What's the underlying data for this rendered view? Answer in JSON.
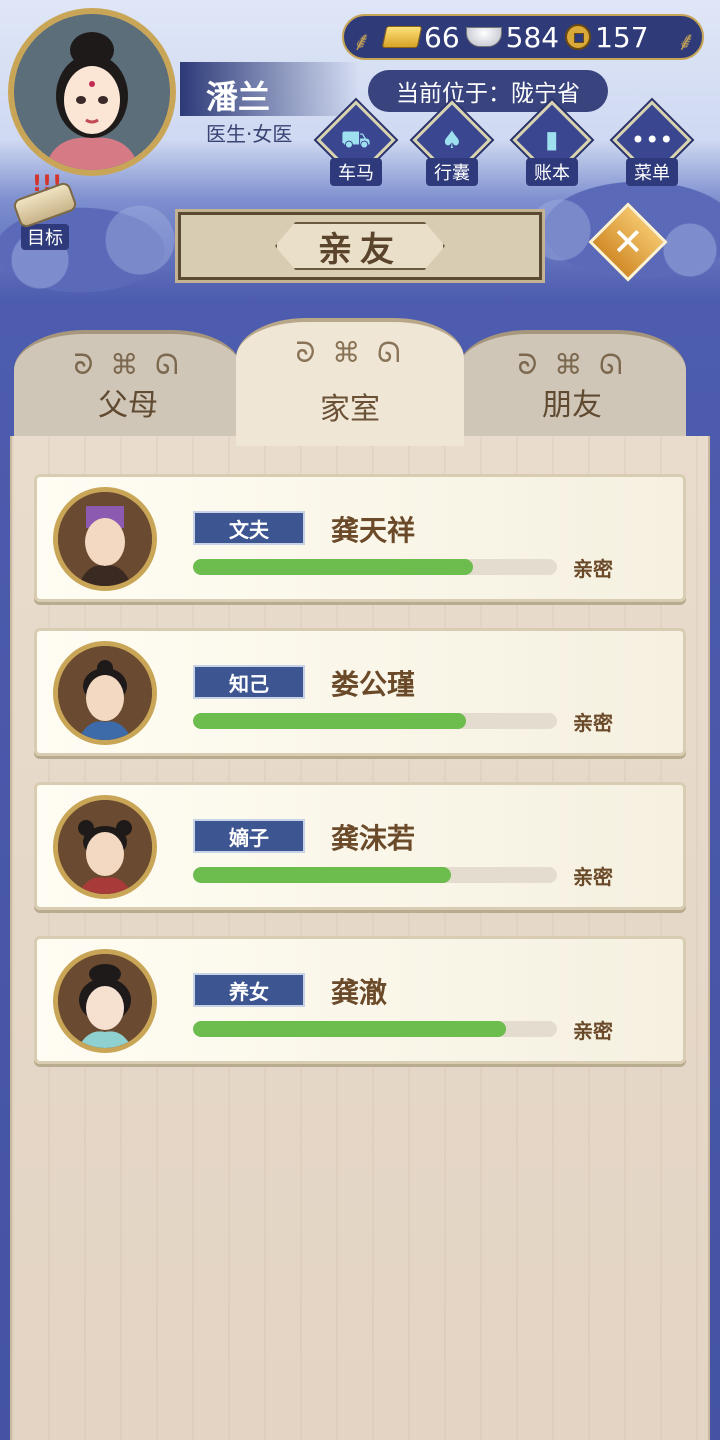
{
  "player": {
    "name": "潘兰",
    "title": "医生·女医"
  },
  "currency": {
    "gold": "66",
    "silver": "584",
    "coins": "157"
  },
  "location": {
    "text": "当前位于：陇宁省"
  },
  "nav": [
    {
      "label": "车马",
      "icon": "carriage-icon"
    },
    {
      "label": "行囊",
      "icon": "bundle-icon"
    },
    {
      "label": "账本",
      "icon": "ledger-icon"
    },
    {
      "label": "菜单",
      "icon": "menu-dots-icon"
    }
  ],
  "goal": {
    "label": "目标"
  },
  "panel": {
    "title": "亲友"
  },
  "tabs": [
    {
      "label": "父母"
    },
    {
      "label": "家室"
    },
    {
      "label": "朋友"
    }
  ],
  "relations": [
    {
      "role": "文夫",
      "name": "龚天祥",
      "status": "亲密",
      "closeness": 0.77
    },
    {
      "role": "知己",
      "name": "娄公瑾",
      "status": "亲密",
      "closeness": 0.75
    },
    {
      "role": "嫡子",
      "name": "龚沫若",
      "status": "亲密",
      "closeness": 0.71
    },
    {
      "role": "养女",
      "name": "龚澈",
      "status": "亲密",
      "closeness": 0.86
    }
  ],
  "colors": {
    "bar": "#6cbc4e",
    "role_badge": "#3d5591",
    "frame_gold": "#c9a657"
  }
}
